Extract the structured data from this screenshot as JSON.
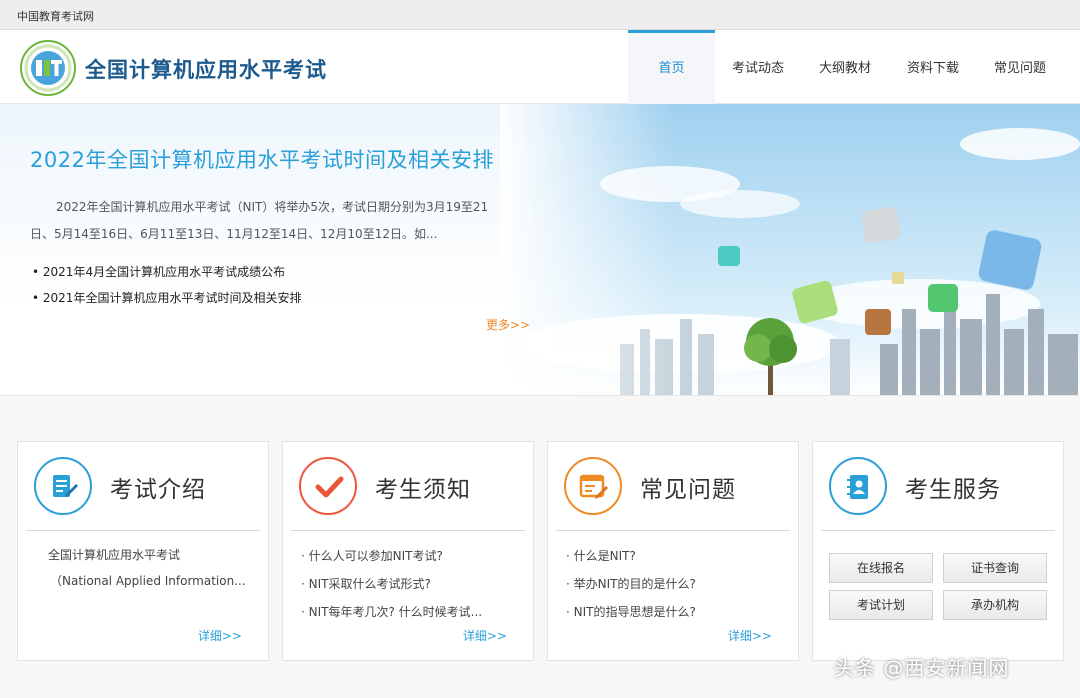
{
  "topstrip": {
    "site_link": "中国教育考试网"
  },
  "header": {
    "site_title": "全国计算机应用水平考试",
    "nav": [
      {
        "label": "首页",
        "active": true
      },
      {
        "label": "考试动态",
        "active": false
      },
      {
        "label": "大纲教材",
        "active": false
      },
      {
        "label": "资料下载",
        "active": false
      },
      {
        "label": "常见问题",
        "active": false
      }
    ]
  },
  "banner": {
    "title": "2022年全国计算机应用水平考试时间及相关安排",
    "description": "2022年全国计算机应用水平考试（NIT）将举办5次，考试日期分别为3月19至21日、5月14至16日、6月11至13日、11月12至14日、12月10至12日。如...",
    "news": [
      "2021年4月全国计算机应用水平考试成绩公布",
      "2021年全国计算机应用水平考试时间及相关安排"
    ],
    "more": "更多>>"
  },
  "cards": {
    "intro": {
      "title": "考试介绍",
      "line1": "全国计算机应用水平考试",
      "line2": "（National Applied Information...",
      "detail": "详细>>"
    },
    "notice": {
      "title": "考生须知",
      "items": [
        "什么人可以参加NIT考试?",
        "NIT采取什么考试形式?",
        "NIT每年考几次? 什么时候考试..."
      ],
      "detail": "详细>>"
    },
    "faq": {
      "title": "常见问题",
      "items": [
        "什么是NIT?",
        "举办NIT的目的是什么?",
        "NIT的指导思想是什么?"
      ],
      "detail": "详细>>"
    },
    "service": {
      "title": "考生服务",
      "buttons": [
        "在线报名",
        "证书查询",
        "考试计划",
        "承办机构"
      ]
    }
  },
  "watermark": "头条 @西安新闻网",
  "colors": {
    "accent": "#2a9fd8",
    "title_blue": "#1c5a8e",
    "more_orange": "#f08a24",
    "notice_red": "#e9573a",
    "faq_orange": "#f08a24"
  }
}
